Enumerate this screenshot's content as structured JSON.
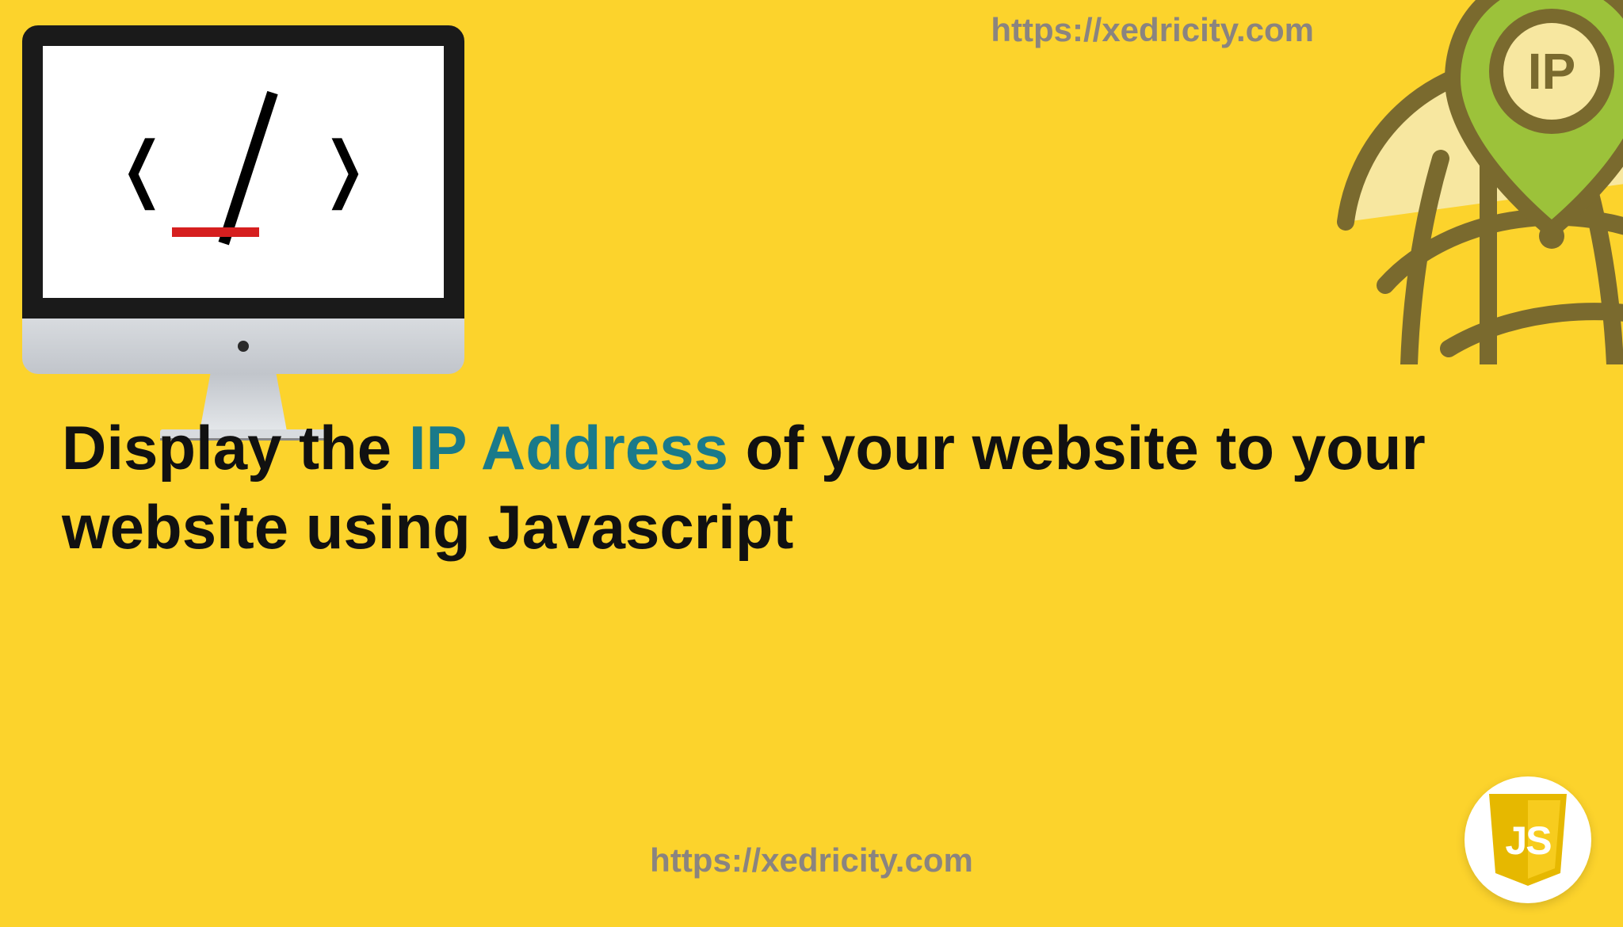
{
  "url_top": "https://xedricity.com",
  "url_bottom": "https://xedricity.com",
  "headline": {
    "part1": "Display the ",
    "accent": "IP Address",
    "part2": " of your website to your website using Javascript"
  },
  "ip_badge_text": "IP",
  "js_badge_text": "JS"
}
